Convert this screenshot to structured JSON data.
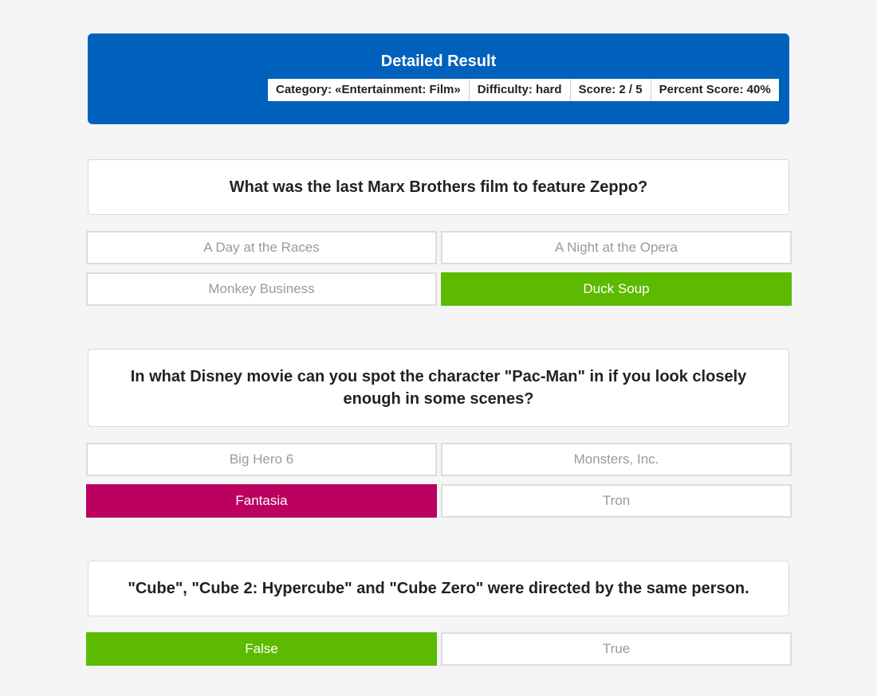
{
  "header": {
    "title": "Detailed Result",
    "category": "Category: «Entertainment: Film»",
    "difficulty": "Difficulty: hard",
    "score": "Score: 2 / 5",
    "percent": "Percent Score: 40%"
  },
  "questions": [
    {
      "text": "What was the last Marx Brothers film to feature Zeppo?",
      "answers": [
        "A Day at the Races",
        "A Night at the Opera",
        "Monkey Business",
        "Duck Soup"
      ]
    },
    {
      "text": "In what Disney movie can you spot the character \"Pac-Man\" in if you look closely enough in some scenes?",
      "answers": [
        "Big Hero 6",
        "Monsters, Inc.",
        "Fantasia",
        "Tron"
      ]
    },
    {
      "text": "\"Cube\", \"Cube 2: Hypercube\" and \"Cube Zero\" were directed by the same person.",
      "answers": [
        "False",
        "True"
      ]
    }
  ],
  "colors": {
    "header_bg": "#0061bd",
    "correct": "#5cba00",
    "wrong": "#bb0060"
  }
}
